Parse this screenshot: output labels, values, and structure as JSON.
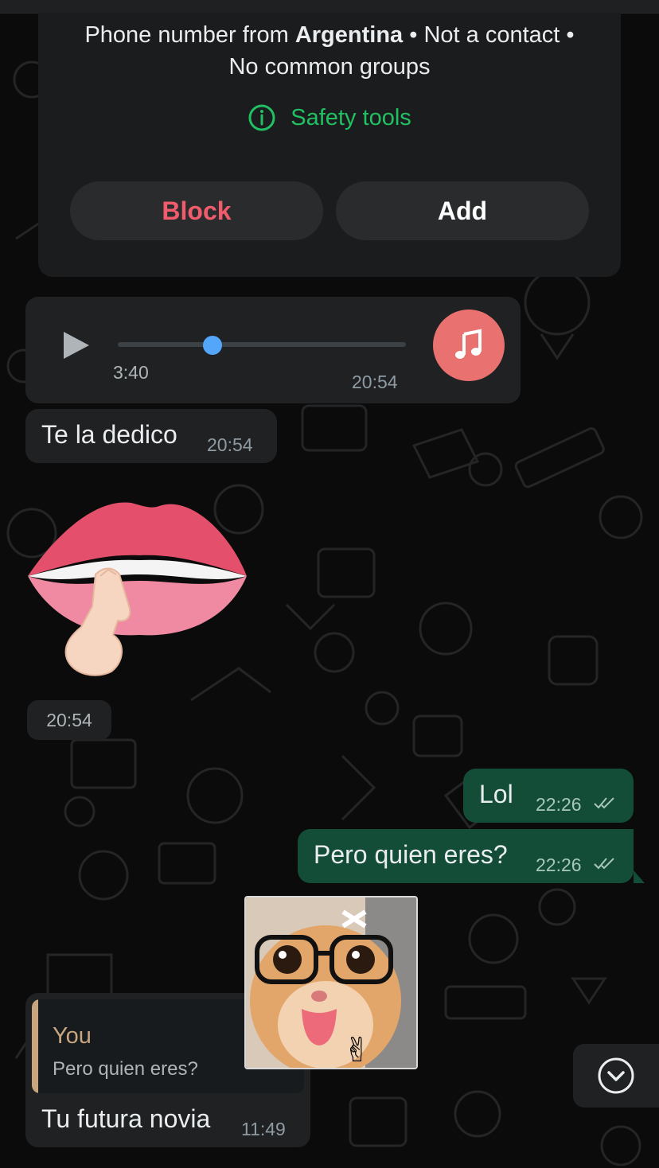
{
  "contact_info": {
    "line1_prefix": "Phone number from",
    "country": "Argentina",
    "line1_suffix": "• Not a contact •",
    "line2": "No common groups",
    "safety_tools_label": "Safety tools",
    "block_label": "Block",
    "add_label": "Add"
  },
  "messages": {
    "audio": {
      "duration": "3:40",
      "time": "20:54",
      "progress": 0.33
    },
    "dedication": {
      "text": "Te la dedico",
      "time": "20:54"
    },
    "sticker": {
      "emoji": "💋",
      "time": "20:54"
    },
    "lol": {
      "text": "Lol",
      "time": "22:26"
    },
    "pero": {
      "text": "Pero quien eres?",
      "time": "22:26"
    },
    "reply": {
      "quoted_author": "You",
      "quoted_text": "Pero quien eres?",
      "text": "Tu futura novia",
      "time": "11:49"
    }
  },
  "colors": {
    "background": "#0b0b0b",
    "incoming_bubble": "#1f2122",
    "outgoing_bubble": "#134d37",
    "accent_green": "#21c063",
    "block_red": "#f15c6d",
    "music_icon_bg": "#e9716f",
    "audio_knob": "#53a6fa"
  },
  "icons": {
    "safety": "info-circle-icon",
    "play": "play-icon",
    "music": "music-note-icon",
    "read_receipt": "double-check-icon",
    "scroll": "chevron-down-circle-icon"
  }
}
